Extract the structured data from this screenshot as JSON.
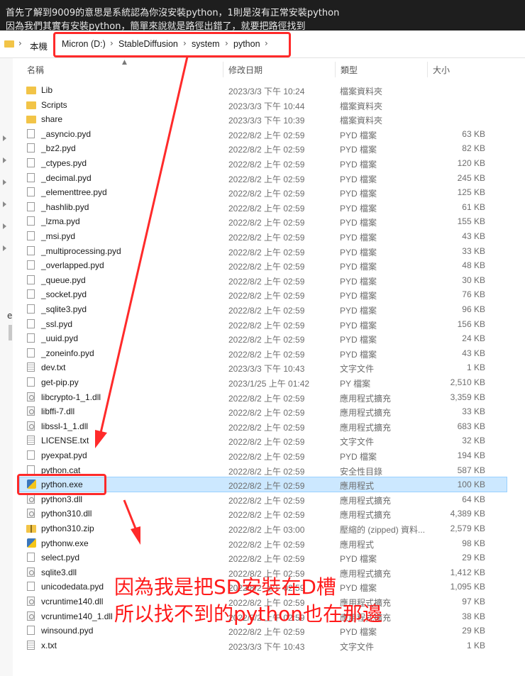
{
  "caption": {
    "line1": "首先了解到9009的意思是系統認為你沒安裝python，1則是沒有正常安裝python",
    "line2": "因為我們其實有安裝python，簡單來說就是路徑出錯了，就要把路徑找到"
  },
  "address_bar": {
    "crumbs": [
      "本機",
      "Micron (D:)",
      "StableDiffusion",
      "system",
      "python"
    ],
    "separator": "›"
  },
  "columns": {
    "name": "名稱",
    "date": "修改日期",
    "type": "類型",
    "size": "大小"
  },
  "left_pane": {
    "cut_text": "e"
  },
  "files": [
    {
      "name": "Lib",
      "date": "2023/3/3 下午 10:24",
      "type": "檔案資料夾",
      "size": "",
      "icon": "folder"
    },
    {
      "name": "Scripts",
      "date": "2023/3/3 下午 10:44",
      "type": "檔案資料夾",
      "size": "",
      "icon": "folder"
    },
    {
      "name": "share",
      "date": "2023/3/3 下午 10:39",
      "type": "檔案資料夾",
      "size": "",
      "icon": "folder"
    },
    {
      "name": "_asyncio.pyd",
      "date": "2022/8/2 上午 02:59",
      "type": "PYD 檔案",
      "size": "63 KB",
      "icon": "file"
    },
    {
      "name": "_bz2.pyd",
      "date": "2022/8/2 上午 02:59",
      "type": "PYD 檔案",
      "size": "82 KB",
      "icon": "file"
    },
    {
      "name": "_ctypes.pyd",
      "date": "2022/8/2 上午 02:59",
      "type": "PYD 檔案",
      "size": "120 KB",
      "icon": "file"
    },
    {
      "name": "_decimal.pyd",
      "date": "2022/8/2 上午 02:59",
      "type": "PYD 檔案",
      "size": "245 KB",
      "icon": "file"
    },
    {
      "name": "_elementtree.pyd",
      "date": "2022/8/2 上午 02:59",
      "type": "PYD 檔案",
      "size": "125 KB",
      "icon": "file"
    },
    {
      "name": "_hashlib.pyd",
      "date": "2022/8/2 上午 02:59",
      "type": "PYD 檔案",
      "size": "61 KB",
      "icon": "file"
    },
    {
      "name": "_lzma.pyd",
      "date": "2022/8/2 上午 02:59",
      "type": "PYD 檔案",
      "size": "155 KB",
      "icon": "file"
    },
    {
      "name": "_msi.pyd",
      "date": "2022/8/2 上午 02:59",
      "type": "PYD 檔案",
      "size": "43 KB",
      "icon": "file"
    },
    {
      "name": "_multiprocessing.pyd",
      "date": "2022/8/2 上午 02:59",
      "type": "PYD 檔案",
      "size": "33 KB",
      "icon": "file"
    },
    {
      "name": "_overlapped.pyd",
      "date": "2022/8/2 上午 02:59",
      "type": "PYD 檔案",
      "size": "48 KB",
      "icon": "file"
    },
    {
      "name": "_queue.pyd",
      "date": "2022/8/2 上午 02:59",
      "type": "PYD 檔案",
      "size": "30 KB",
      "icon": "file"
    },
    {
      "name": "_socket.pyd",
      "date": "2022/8/2 上午 02:59",
      "type": "PYD 檔案",
      "size": "76 KB",
      "icon": "file"
    },
    {
      "name": "_sqlite3.pyd",
      "date": "2022/8/2 上午 02:59",
      "type": "PYD 檔案",
      "size": "96 KB",
      "icon": "file"
    },
    {
      "name": "_ssl.pyd",
      "date": "2022/8/2 上午 02:59",
      "type": "PYD 檔案",
      "size": "156 KB",
      "icon": "file"
    },
    {
      "name": "_uuid.pyd",
      "date": "2022/8/2 上午 02:59",
      "type": "PYD 檔案",
      "size": "24 KB",
      "icon": "file"
    },
    {
      "name": "_zoneinfo.pyd",
      "date": "2022/8/2 上午 02:59",
      "type": "PYD 檔案",
      "size": "43 KB",
      "icon": "file"
    },
    {
      "name": "dev.txt",
      "date": "2023/3/3 下午 10:43",
      "type": "文字文件",
      "size": "1 KB",
      "icon": "txt"
    },
    {
      "name": "get-pip.py",
      "date": "2023/1/25 上午 01:42",
      "type": "PY 檔案",
      "size": "2,510 KB",
      "icon": "file"
    },
    {
      "name": "libcrypto-1_1.dll",
      "date": "2022/8/2 上午 02:59",
      "type": "應用程式擴充",
      "size": "3,359 KB",
      "icon": "dll"
    },
    {
      "name": "libffi-7.dll",
      "date": "2022/8/2 上午 02:59",
      "type": "應用程式擴充",
      "size": "33 KB",
      "icon": "dll"
    },
    {
      "name": "libssl-1_1.dll",
      "date": "2022/8/2 上午 02:59",
      "type": "應用程式擴充",
      "size": "683 KB",
      "icon": "dll"
    },
    {
      "name": "LICENSE.txt",
      "date": "2022/8/2 上午 02:59",
      "type": "文字文件",
      "size": "32 KB",
      "icon": "txt"
    },
    {
      "name": "pyexpat.pyd",
      "date": "2022/8/2 上午 02:59",
      "type": "PYD 檔案",
      "size": "194 KB",
      "icon": "file"
    },
    {
      "name": "python.cat",
      "date": "2022/8/2 上午 02:59",
      "type": "安全性目錄",
      "size": "587 KB",
      "icon": "file"
    },
    {
      "name": "python.exe",
      "date": "2022/8/2 上午 02:59",
      "type": "應用程式",
      "size": "100 KB",
      "icon": "exe",
      "selected": true
    },
    {
      "name": "python3.dll",
      "date": "2022/8/2 上午 02:59",
      "type": "應用程式擴充",
      "size": "64 KB",
      "icon": "dll"
    },
    {
      "name": "python310.dll",
      "date": "2022/8/2 上午 02:59",
      "type": "應用程式擴充",
      "size": "4,389 KB",
      "icon": "dll"
    },
    {
      "name": "python310.zip",
      "date": "2022/8/2 上午 03:00",
      "type": "壓縮的 (zipped) 資料...",
      "size": "2,579 KB",
      "icon": "zip"
    },
    {
      "name": "pythonw.exe",
      "date": "2022/8/2 上午 02:59",
      "type": "應用程式",
      "size": "98 KB",
      "icon": "exe"
    },
    {
      "name": "select.pyd",
      "date": "2022/8/2 上午 02:59",
      "type": "PYD 檔案",
      "size": "29 KB",
      "icon": "file"
    },
    {
      "name": "sqlite3.dll",
      "date": "2022/8/2 上午 02:59",
      "type": "應用程式擴充",
      "size": "1,412 KB",
      "icon": "dll"
    },
    {
      "name": "unicodedata.pyd",
      "date": "2022/8/2 上午 02:59",
      "type": "PYD 檔案",
      "size": "1,095 KB",
      "icon": "file"
    },
    {
      "name": "vcruntime140.dll",
      "date": "2022/8/2 上午 02:59",
      "type": "應用程式擴充",
      "size": "97 KB",
      "icon": "dll"
    },
    {
      "name": "vcruntime140_1.dll",
      "date": "2022/8/2 上午 02:59",
      "type": "應用程式擴充",
      "size": "38 KB",
      "icon": "dll"
    },
    {
      "name": "winsound.pyd",
      "date": "2022/8/2 上午 02:59",
      "type": "PYD 檔案",
      "size": "29 KB",
      "icon": "file"
    },
    {
      "name": "x.txt",
      "date": "2023/3/3 下午 10:43",
      "type": "文字文件",
      "size": "1 KB",
      "icon": "txt"
    }
  ],
  "annotation": {
    "line1": "因為我是把SD安裝在D槽",
    "line2": "所以找不到的python也在那邊",
    "color": "#ff1a1a"
  },
  "colors": {
    "selection": "#cce8ff",
    "highlight_box": "#ff2a2a",
    "folder": "#f2c447"
  }
}
